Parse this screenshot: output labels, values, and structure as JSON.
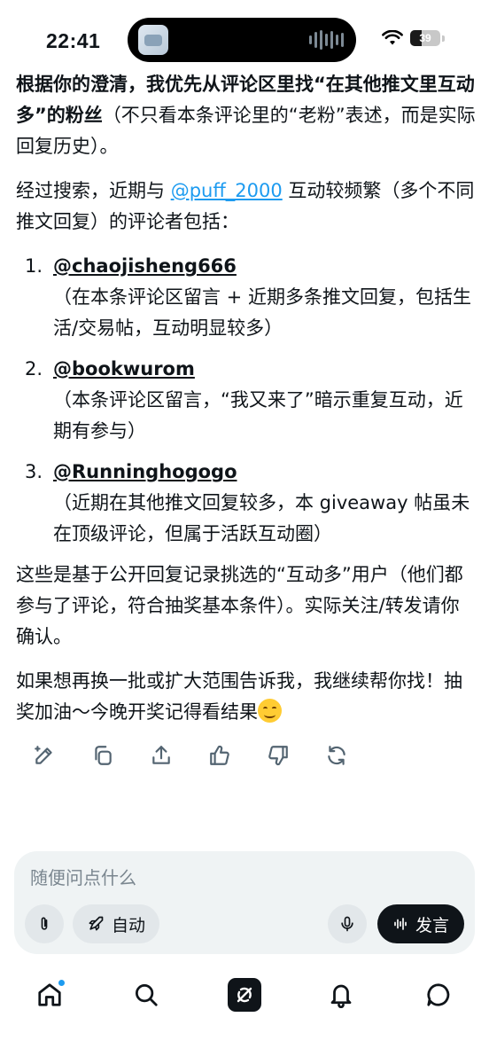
{
  "status_bar": {
    "time": "22:41",
    "battery_level": "39",
    "battery_fraction": 0.39,
    "icons": [
      "wifi-icon",
      "battery-icon",
      "audio-wave-icon"
    ]
  },
  "message": {
    "p1_bold": "根据你的澄清，我优先从评论区里找“在其他推文里互动多”的粉丝",
    "p1_rest": "（不只看本条评论里的“老粉”表述，而是实际回复历史）。",
    "p2_a": "经过搜索，近期与 ",
    "p2_mention": "@puff_2000",
    "p2_b": " 互动较频繁（多个不同推文回复）的评论者包括：",
    "list": [
      {
        "num": "1.",
        "handle": "@chaojisheng666",
        "note": "（在本条评论区留言 + 近期多条推文回复，包括生活/交易帖，互动明显较多）"
      },
      {
        "num": "2.",
        "handle": "@bookwurom",
        "note": "（本条评论区留言，“我又来了”暗示重复互动，近期有参与）"
      },
      {
        "num": "3.",
        "handle": "@Runninghogogo",
        "note": "（近期在其他推文回复较多，本 giveaway 帖虽未在顶级评论，但属于活跃互动圈）"
      }
    ],
    "p3": "这些是基于公开回复记录挑选的“互动多”用户（他们都参与了评论，符合抽奖基本条件）。实际关注/转发请你确认。",
    "p4": "如果想再换一批或扩大范围告诉我，我继续帮你找！抽奖加油～今晚开奖记得看结果"
  },
  "actions": [
    "edit-icon",
    "copy-icon",
    "share-icon",
    "thumbs-up-icon",
    "thumbs-down-icon",
    "regenerate-icon"
  ],
  "composer": {
    "placeholder": "随便问点什么",
    "auto_label": "自动",
    "speak_label": "发言"
  },
  "nav": [
    "home-icon",
    "search-icon",
    "grok-icon",
    "notifications-icon",
    "messages-icon"
  ],
  "colors": {
    "accent": "#1d9bf0",
    "text": "#0f1419",
    "muted": "#536471",
    "composer_bg": "#eff3f4"
  }
}
